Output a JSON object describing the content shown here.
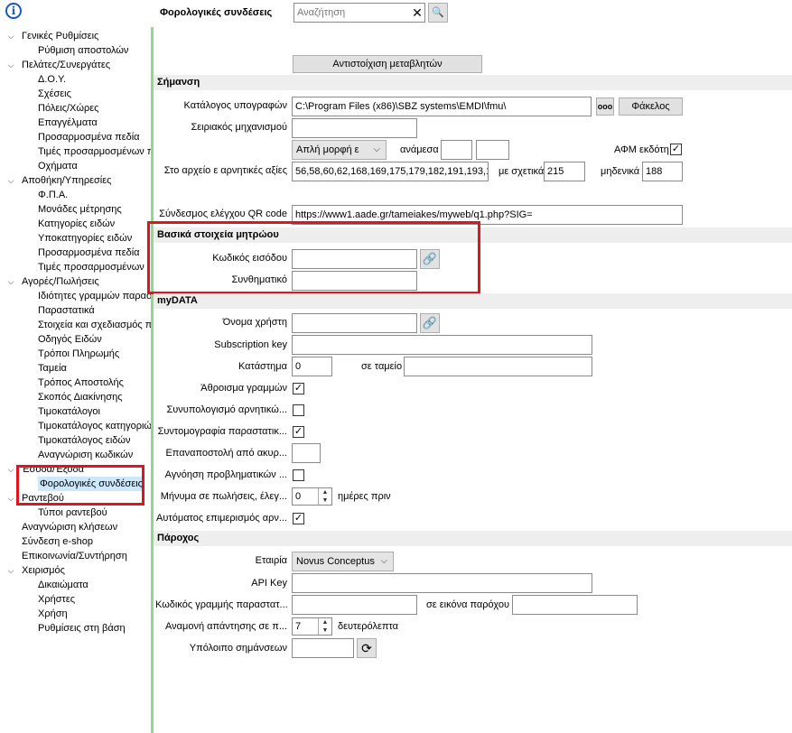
{
  "header": {
    "title": "Φορολογικές συνδέσεις",
    "search_placeholder": "Αναζήτηση",
    "clear_glyph": "✕",
    "search_glyph": "🔍"
  },
  "sidebar": {
    "items": [
      {
        "label": "Γενικές Ρυθμίσεις",
        "level": 0,
        "expanded": true
      },
      {
        "label": "Ρύθμιση αποστολών",
        "level": 1
      },
      {
        "label": "Πελάτες/Συνεργάτες",
        "level": 0,
        "expanded": true
      },
      {
        "label": "Δ.Ο.Υ.",
        "level": 1
      },
      {
        "label": "Σχέσεις",
        "level": 1
      },
      {
        "label": "Πόλεις/Χώρες",
        "level": 1
      },
      {
        "label": "Επαγγέλματα",
        "level": 1
      },
      {
        "label": "Προσαρμοσμένα πεδία",
        "level": 1
      },
      {
        "label": "Τιμές προσαρμοσμένων π",
        "level": 1
      },
      {
        "label": "Οχήματα",
        "level": 1
      },
      {
        "label": "Αποθήκη/Υπηρεσίες",
        "level": 0,
        "expanded": true
      },
      {
        "label": "Φ.Π.Α.",
        "level": 1
      },
      {
        "label": "Μονάδες μέτρησης",
        "level": 1
      },
      {
        "label": "Κατηγορίες ειδών",
        "level": 1
      },
      {
        "label": "Υποκατηγορίες ειδών",
        "level": 1
      },
      {
        "label": "Προσαρμοσμένα πεδία",
        "level": 1
      },
      {
        "label": "Τιμές προσαρμοσμένων",
        "level": 1
      },
      {
        "label": "Αγορές/Πωλήσεις",
        "level": 0,
        "expanded": true
      },
      {
        "label": "Ιδιότητες γραμμών παραστ",
        "level": 1
      },
      {
        "label": "Παραστατικά",
        "level": 1
      },
      {
        "label": "Στοιχεία και σχεδιασμός π",
        "level": 1
      },
      {
        "label": "Οδηγός Ειδών",
        "level": 1
      },
      {
        "label": "Τρόποι Πληρωμής",
        "level": 1
      },
      {
        "label": "Ταμεία",
        "level": 1
      },
      {
        "label": "Τρόπος Αποστολής",
        "level": 1
      },
      {
        "label": "Σκοπός Διακίνησης",
        "level": 1
      },
      {
        "label": "Τιμοκατάλογοι",
        "level": 1
      },
      {
        "label": "Τιμοκατάλογος κατηγοριώ",
        "level": 1
      },
      {
        "label": "Τιμοκατάλογος ειδών",
        "level": 1
      },
      {
        "label": "Αναγνώριση κωδικών",
        "level": 1
      },
      {
        "label": "Έσοδα/Έξοδα",
        "level": 0,
        "expanded": true
      },
      {
        "label": "Φορολογικές συνδέσεις",
        "level": 1,
        "selected": true
      },
      {
        "label": "Ραντεβού",
        "level": 0,
        "expanded": true
      },
      {
        "label": "Τύποι ραντεβού",
        "level": 1
      },
      {
        "label": "Αναγνώριση κλήσεων",
        "level": 0
      },
      {
        "label": "Σύνδεση e-shop",
        "level": 0
      },
      {
        "label": "Επικοινωνία/Συντήρηση",
        "level": 0
      },
      {
        "label": "Χειρισμός",
        "level": 0,
        "expanded": true
      },
      {
        "label": "Δικαιώματα",
        "level": 1
      },
      {
        "label": "Χρήστες",
        "level": 1
      },
      {
        "label": "Χρήση",
        "level": 1
      },
      {
        "label": "Ρυθμίσεις στη βάση",
        "level": 1
      }
    ]
  },
  "main": {
    "map_variables_button": "Αντιστοίχιση μεταβλητών",
    "signing": {
      "section_title": "Σήμανση",
      "catalog_label": "Κατάλογος υπογραφών",
      "catalog_value": "C:\\Program Files (x86)\\SBZ systems\\EMDI\\fmu\\",
      "browse_button": "ooo",
      "folder_button": "Φάκελος",
      "device_serial_label": "Σειριακός μηχανισμού",
      "device_serial_value": "",
      "format_select": "Απλή μορφή ε",
      "between_label": "ανάμεσα",
      "between_from": "",
      "between_to": "",
      "issuer_vat_label": "ΑΦΜ εκδότη",
      "issuer_vat_checked": "✓",
      "negative_values_label": "Στο αρχείο ε αρνητικές αξίες",
      "negative_values_value": "56,58,60,62,168,169,175,179,182,191,193,1",
      "relative_label": "με σχετικά",
      "relative_value": "215",
      "zeros_label": "μηδενικά",
      "zeros_value": "188",
      "qr_label": "Σύνδεσμος ελέγχου QR code",
      "qr_value": "https://www1.aade.gr/tameiakes/myweb/q1.php?SIG="
    },
    "registry": {
      "section_title": "Βασικά στοιχεία μητρώου",
      "login_code_label": "Κωδικός εισόδου",
      "login_code_value": "",
      "password_label": "Συνθηματικό",
      "password_value": ""
    },
    "mydata": {
      "section_title": "myDATA",
      "username_label": "Όνομα χρήστη",
      "username_value": "",
      "subscription_label": "Subscription key",
      "subscription_value": "",
      "store_label": "Κατάστημα",
      "store_value": "0",
      "in_cashbox_label": "σε ταμείο",
      "in_cashbox_value": "",
      "line_sum_label": "Άθροισμα γραμμών",
      "line_sum_checked": "✓",
      "negative_calc_label": "Συνυπολογισμό αρνητικώ...",
      "negative_calc_checked": "",
      "doc_abbrev_label": "Συντομογραφία παραστατικ...",
      "doc_abbrev_checked": "✓",
      "resend_label": "Επαναποστολή από ακυρ...",
      "resend_value": "",
      "ignore_label": "Αγνόηση προβληματικών ...",
      "ignore_checked": "",
      "message_label": "Μήνυμα σε πωλήσεις, έλεγ...",
      "message_value": "0",
      "days_before_label": "ημέρες πριν",
      "auto_split_label": "Αυτόματος επιμερισμός αρν...",
      "auto_split_checked": "✓"
    },
    "provider": {
      "section_title": "Πάροχος",
      "company_label": "Εταιρία",
      "company_value": "Novus Conceptus",
      "api_key_label": "API Key",
      "api_key_value": "",
      "doc_line_code_label": "Κωδικός γραμμής παραστατ...",
      "doc_line_code_value": "",
      "provider_image_label": "σε εικόνα παρόχου",
      "provider_image_value": "",
      "wait_label": "Αναμονή απάντησης σε π...",
      "wait_value": "7",
      "seconds_label": "δευτερόλεπτα",
      "remaining_label": "Υπόλοιπο σημάνσεων",
      "remaining_value": ""
    }
  },
  "colors": {
    "highlight_red": "#e0141e",
    "divider_green": "#8fd88f",
    "selected_bg": "#cce8ff",
    "section_bg": "#eeeeee"
  }
}
